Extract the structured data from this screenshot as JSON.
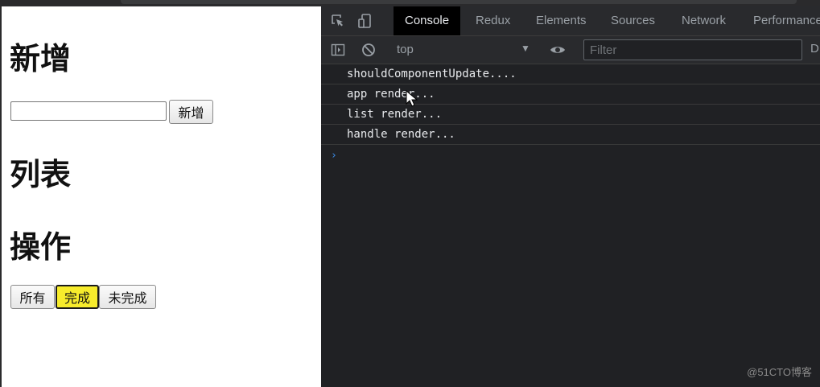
{
  "app": {
    "add_heading": "新增",
    "add_input_value": "",
    "add_button": "新增",
    "list_heading": "列表",
    "op_heading": "操作",
    "filter_buttons": [
      {
        "label": "所有"
      },
      {
        "label": "完成",
        "active": true,
        "active_color": "#f7ec2c"
      },
      {
        "label": "未完成"
      }
    ]
  },
  "devtools": {
    "tabs": [
      {
        "label": "Console",
        "active": true
      },
      {
        "label": "Redux"
      },
      {
        "label": "Elements"
      },
      {
        "label": "Sources"
      },
      {
        "label": "Network"
      },
      {
        "label": "Performance"
      }
    ],
    "context": "top",
    "filter_placeholder": "Filter",
    "levels_label": "D",
    "console_logs": [
      "shouldComponentUpdate....",
      "app render...",
      "list render...",
      "handle render..."
    ],
    "prompt": "›"
  },
  "watermark": "@51CTO博客",
  "colors": {
    "devtools_bg": "#202124",
    "accent": "#3b8eea",
    "highlight": "#f7ec2c"
  }
}
